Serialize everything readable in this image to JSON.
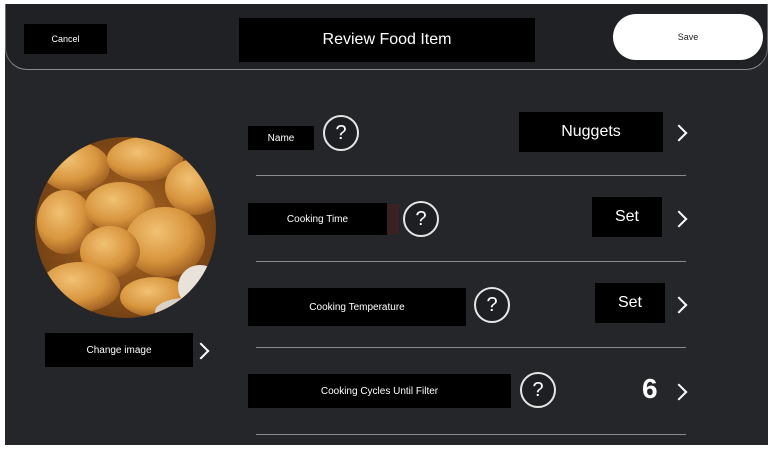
{
  "header": {
    "cancel_label": "Cancel",
    "title": "Review Food Item",
    "save_label": "Save"
  },
  "image_panel": {
    "change_image_label": "Change image"
  },
  "fields": [
    {
      "label": "Name",
      "help": "?",
      "value": "Nuggets"
    },
    {
      "label": "Cooking Time",
      "help": "?",
      "value": "Set"
    },
    {
      "label": "Cooking Temperature",
      "help": "?",
      "value": "Set"
    },
    {
      "label": "Cooking Cycles Until Filter",
      "help": "?",
      "value": "6"
    }
  ],
  "icons": {
    "chevron": "chevron-right-icon",
    "help": "question-mark-circle-icon"
  },
  "colors": {
    "background": "#25262a",
    "header": "#202124",
    "accent": "#000000",
    "save_button": "#ffffff"
  }
}
